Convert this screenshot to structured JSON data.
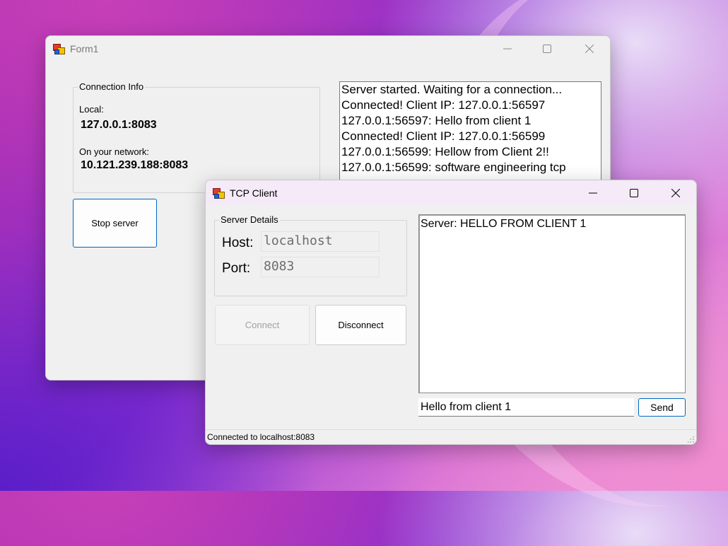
{
  "form1": {
    "title": "Form1",
    "connection_info": {
      "legend": "Connection Info",
      "local_label": "Local:",
      "local_value": "127.0.0.1:8083",
      "network_label": "On your network:",
      "network_value": "10.121.239.188:8083"
    },
    "stop_button": "Stop server",
    "log": [
      "Server started. Waiting for a connection...",
      "Connected! Client IP: 127.0.0.1:56597",
      "127.0.0.1:56597: Hello from client 1",
      "Connected! Client IP: 127.0.0.1:56599",
      "127.0.0.1:56599: Hellow from Client 2!!",
      "127.0.0.1:56599: software engineering tcp"
    ]
  },
  "tcp_client": {
    "title": "TCP Client",
    "server_details": {
      "legend": "Server Details",
      "host_label": "Host:",
      "host_value": "localhost",
      "port_label": "Port:",
      "port_value": "8083"
    },
    "connect_button": "Connect",
    "disconnect_button": "Disconnect",
    "messages": [
      "Server: HELLO FROM CLIENT 1"
    ],
    "message_input_value": "Hello from client 1",
    "send_button": "Send",
    "status": "Connected to localhost:8083"
  },
  "colors": {
    "window_bg": "#f0f0f0",
    "active_titlebar": "#f5eaf7",
    "button_focus_border": "#0067c0",
    "disabled_text": "#a0a0a0"
  }
}
